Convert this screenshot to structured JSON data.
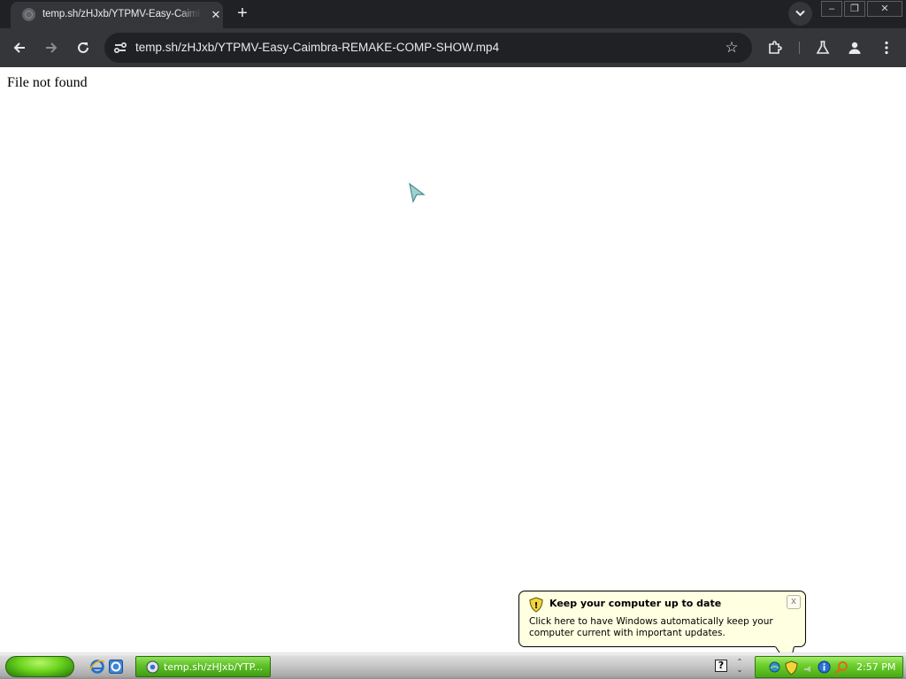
{
  "browser": {
    "tab": {
      "title": "temp.sh/zHJxb/YTPMV-Easy-Caimbra-REMAKE-COMP-SHOW.mp4",
      "close_glyph": "✕"
    },
    "new_tab_glyph": "+",
    "window_controls": {
      "minimize": "–",
      "restore": "❐",
      "close": "✕"
    },
    "address_bar": {
      "url": "temp.sh/zHJxb/YTPMV-Easy-Caimbra-REMAKE-COMP-SHOW.mp4"
    },
    "bookmark_glyph": "☆",
    "icons": [
      "back-icon",
      "forward-icon",
      "reload-icon",
      "site-info-icon",
      "star-icon",
      "extensions-icon",
      "labs-icon",
      "profile-icon",
      "menu-icon"
    ]
  },
  "page": {
    "text": "File not found"
  },
  "balloon": {
    "title": "Keep your computer up to date",
    "body": "Click here to have Windows automatically keep your computer current with important updates.",
    "close_glyph": "x"
  },
  "taskbar": {
    "task_button_label": "temp.sh/zHJxb/YTP...",
    "help_glyph": "?",
    "tray_arrows": "⌃\n⌄",
    "clock": "2:57 PM",
    "colors": {
      "start": "#3a9610",
      "task": "#5fc026",
      "tray": "#6ccf2c"
    }
  }
}
